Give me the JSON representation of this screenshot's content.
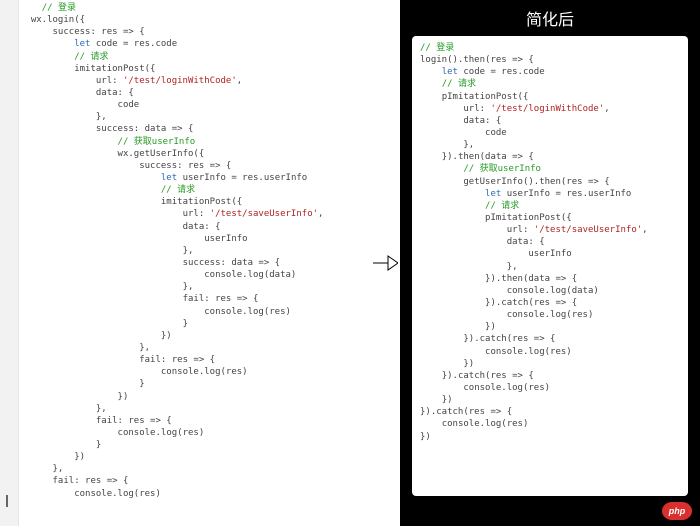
{
  "right_title": "简化后",
  "badge": "php",
  "left_code": [
    {
      "i": 2,
      "spans": [
        {
          "c": "tok-c",
          "t": "// 登录"
        }
      ]
    },
    {
      "i": 1,
      "spans": [
        {
          "c": "tok-p",
          "t": "wx.login({"
        }
      ]
    },
    {
      "i": 3,
      "spans": [
        {
          "c": "tok-p",
          "t": "success: res => {"
        }
      ]
    },
    {
      "i": 5,
      "spans": [
        {
          "c": "tok-k",
          "t": "let"
        },
        {
          "c": "tok-p",
          "t": " code = res.code"
        }
      ]
    },
    {
      "i": 5,
      "spans": [
        {
          "c": "tok-c",
          "t": "// 请求"
        }
      ]
    },
    {
      "i": 5,
      "spans": [
        {
          "c": "tok-p",
          "t": "imitationPost({"
        }
      ]
    },
    {
      "i": 7,
      "spans": [
        {
          "c": "tok-p",
          "t": "url: "
        },
        {
          "c": "tok-s",
          "t": "'/test/loginWithCode'"
        },
        {
          "c": "tok-p",
          "t": ","
        }
      ]
    },
    {
      "i": 7,
      "spans": [
        {
          "c": "tok-p",
          "t": "data: {"
        }
      ]
    },
    {
      "i": 9,
      "spans": [
        {
          "c": "tok-p",
          "t": "code"
        }
      ]
    },
    {
      "i": 7,
      "spans": [
        {
          "c": "tok-p",
          "t": "},"
        }
      ]
    },
    {
      "i": 7,
      "spans": [
        {
          "c": "tok-p",
          "t": "success: data => {"
        }
      ]
    },
    {
      "i": 9,
      "spans": [
        {
          "c": "tok-c",
          "t": "// 获取userInfo"
        }
      ]
    },
    {
      "i": 9,
      "spans": [
        {
          "c": "tok-p",
          "t": "wx.getUserInfo({"
        }
      ]
    },
    {
      "i": 11,
      "spans": [
        {
          "c": "tok-p",
          "t": "success: res => {"
        }
      ]
    },
    {
      "i": 13,
      "spans": [
        {
          "c": "tok-k",
          "t": "let"
        },
        {
          "c": "tok-p",
          "t": " userInfo = res.userInfo"
        }
      ]
    },
    {
      "i": 13,
      "spans": [
        {
          "c": "tok-c",
          "t": "// 请求"
        }
      ]
    },
    {
      "i": 13,
      "spans": [
        {
          "c": "tok-p",
          "t": "imitationPost({"
        }
      ]
    },
    {
      "i": 15,
      "spans": [
        {
          "c": "tok-p",
          "t": "url: "
        },
        {
          "c": "tok-s",
          "t": "'/test/saveUserInfo'"
        },
        {
          "c": "tok-p",
          "t": ","
        }
      ]
    },
    {
      "i": 15,
      "spans": [
        {
          "c": "tok-p",
          "t": "data: {"
        }
      ]
    },
    {
      "i": 17,
      "spans": [
        {
          "c": "tok-p",
          "t": "userInfo"
        }
      ]
    },
    {
      "i": 15,
      "spans": [
        {
          "c": "tok-p",
          "t": "},"
        }
      ]
    },
    {
      "i": 15,
      "spans": [
        {
          "c": "tok-p",
          "t": "success: data => {"
        }
      ]
    },
    {
      "i": 17,
      "spans": [
        {
          "c": "tok-p",
          "t": "console.log(data)"
        }
      ]
    },
    {
      "i": 15,
      "spans": [
        {
          "c": "tok-p",
          "t": "},"
        }
      ]
    },
    {
      "i": 15,
      "spans": [
        {
          "c": "tok-p",
          "t": "fail: res => {"
        }
      ]
    },
    {
      "i": 17,
      "spans": [
        {
          "c": "tok-p",
          "t": "console.log(res)"
        }
      ]
    },
    {
      "i": 15,
      "spans": [
        {
          "c": "tok-p",
          "t": "}"
        }
      ]
    },
    {
      "i": 13,
      "spans": [
        {
          "c": "tok-p",
          "t": "})"
        }
      ]
    },
    {
      "i": 11,
      "spans": [
        {
          "c": "tok-p",
          "t": "},"
        }
      ]
    },
    {
      "i": 11,
      "spans": [
        {
          "c": "tok-p",
          "t": "fail: res => {"
        }
      ]
    },
    {
      "i": 13,
      "spans": [
        {
          "c": "tok-p",
          "t": "console.log(res)"
        }
      ]
    },
    {
      "i": 11,
      "spans": [
        {
          "c": "tok-p",
          "t": "}"
        }
      ]
    },
    {
      "i": 9,
      "spans": [
        {
          "c": "tok-p",
          "t": "})"
        }
      ]
    },
    {
      "i": 7,
      "spans": [
        {
          "c": "tok-p",
          "t": "},"
        }
      ]
    },
    {
      "i": 7,
      "spans": [
        {
          "c": "tok-p",
          "t": "fail: res => {"
        }
      ]
    },
    {
      "i": 9,
      "spans": [
        {
          "c": "tok-p",
          "t": "console.log(res)"
        }
      ]
    },
    {
      "i": 7,
      "spans": [
        {
          "c": "tok-p",
          "t": "}"
        }
      ]
    },
    {
      "i": 5,
      "spans": [
        {
          "c": "tok-p",
          "t": "})"
        }
      ]
    },
    {
      "i": 3,
      "spans": [
        {
          "c": "tok-p",
          "t": "},"
        }
      ]
    },
    {
      "i": 3,
      "spans": [
        {
          "c": "tok-p",
          "t": "fail: res => {"
        }
      ]
    },
    {
      "i": 5,
      "spans": [
        {
          "c": "tok-p",
          "t": "console.log(res)"
        }
      ]
    }
  ],
  "right_code": [
    {
      "i": 0,
      "spans": [
        {
          "c": "tok-c",
          "t": "// 登录"
        }
      ]
    },
    {
      "i": 0,
      "spans": [
        {
          "c": "tok-p",
          "t": "login().then(res => {"
        }
      ]
    },
    {
      "i": 2,
      "spans": [
        {
          "c": "tok-k",
          "t": "let"
        },
        {
          "c": "tok-p",
          "t": " code = res.code"
        }
      ]
    },
    {
      "i": 2,
      "spans": [
        {
          "c": "tok-c",
          "t": "// 请求"
        }
      ]
    },
    {
      "i": 2,
      "spans": [
        {
          "c": "tok-p",
          "t": "pImitationPost({"
        }
      ]
    },
    {
      "i": 4,
      "spans": [
        {
          "c": "tok-p",
          "t": "url: "
        },
        {
          "c": "tok-s",
          "t": "'/test/loginWithCode'"
        },
        {
          "c": "tok-p",
          "t": ","
        }
      ]
    },
    {
      "i": 4,
      "spans": [
        {
          "c": "tok-p",
          "t": "data: {"
        }
      ]
    },
    {
      "i": 6,
      "spans": [
        {
          "c": "tok-p",
          "t": "code"
        }
      ]
    },
    {
      "i": 4,
      "spans": [
        {
          "c": "tok-p",
          "t": "},"
        }
      ]
    },
    {
      "i": 2,
      "spans": [
        {
          "c": "tok-p",
          "t": "}).then(data => {"
        }
      ]
    },
    {
      "i": 4,
      "spans": [
        {
          "c": "tok-c",
          "t": "// 获取userInfo"
        }
      ]
    },
    {
      "i": 4,
      "spans": [
        {
          "c": "tok-p",
          "t": "getUserInfo().then(res => {"
        }
      ]
    },
    {
      "i": 6,
      "spans": [
        {
          "c": "tok-k",
          "t": "let"
        },
        {
          "c": "tok-p",
          "t": " userInfo = res.userInfo"
        }
      ]
    },
    {
      "i": 6,
      "spans": [
        {
          "c": "tok-c",
          "t": "// 请求"
        }
      ]
    },
    {
      "i": 6,
      "spans": [
        {
          "c": "tok-p",
          "t": "pImitationPost({"
        }
      ]
    },
    {
      "i": 8,
      "spans": [
        {
          "c": "tok-p",
          "t": "url: "
        },
        {
          "c": "tok-s",
          "t": "'/test/saveUserInfo'"
        },
        {
          "c": "tok-p",
          "t": ","
        }
      ]
    },
    {
      "i": 8,
      "spans": [
        {
          "c": "tok-p",
          "t": "data: {"
        }
      ]
    },
    {
      "i": 10,
      "spans": [
        {
          "c": "tok-p",
          "t": "userInfo"
        }
      ]
    },
    {
      "i": 8,
      "spans": [
        {
          "c": "tok-p",
          "t": "},"
        }
      ]
    },
    {
      "i": 6,
      "spans": [
        {
          "c": "tok-p",
          "t": "}).then(data => {"
        }
      ]
    },
    {
      "i": 8,
      "spans": [
        {
          "c": "tok-p",
          "t": "console.log(data)"
        }
      ]
    },
    {
      "i": 6,
      "spans": [
        {
          "c": "tok-p",
          "t": "}).catch(res => {"
        }
      ]
    },
    {
      "i": 8,
      "spans": [
        {
          "c": "tok-p",
          "t": "console.log(res)"
        }
      ]
    },
    {
      "i": 6,
      "spans": [
        {
          "c": "tok-p",
          "t": "})"
        }
      ]
    },
    {
      "i": 4,
      "spans": [
        {
          "c": "tok-p",
          "t": "}).catch(res => {"
        }
      ]
    },
    {
      "i": 6,
      "spans": [
        {
          "c": "tok-p",
          "t": "console.log(res)"
        }
      ]
    },
    {
      "i": 4,
      "spans": [
        {
          "c": "tok-p",
          "t": "})"
        }
      ]
    },
    {
      "i": 2,
      "spans": [
        {
          "c": "tok-p",
          "t": "}).catch(res => {"
        }
      ]
    },
    {
      "i": 4,
      "spans": [
        {
          "c": "tok-p",
          "t": "console.log(res)"
        }
      ]
    },
    {
      "i": 2,
      "spans": [
        {
          "c": "tok-p",
          "t": "})"
        }
      ]
    },
    {
      "i": 0,
      "spans": [
        {
          "c": "tok-p",
          "t": "}).catch(res => {"
        }
      ]
    },
    {
      "i": 2,
      "spans": [
        {
          "c": "tok-p",
          "t": "console.log(res)"
        }
      ]
    },
    {
      "i": 0,
      "spans": [
        {
          "c": "tok-p",
          "t": "})"
        }
      ]
    }
  ]
}
